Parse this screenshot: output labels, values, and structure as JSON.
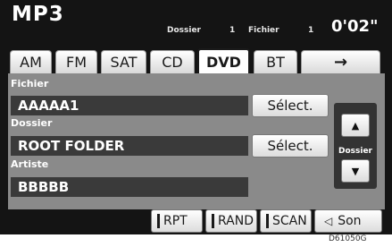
{
  "header": {
    "title": "MP3",
    "folder_label": "Dossier",
    "folder_number": "1",
    "file_label": "Fichier",
    "file_number": "1",
    "elapsed_time": "0'02\""
  },
  "tabs": [
    {
      "label": "AM"
    },
    {
      "label": "FM"
    },
    {
      "label": "SAT"
    },
    {
      "label": "CD"
    },
    {
      "label": "DVD",
      "active": true
    },
    {
      "label": "BT"
    },
    {
      "label": "→"
    }
  ],
  "fields": {
    "file": {
      "label": "Fichier",
      "value": "AAAAA1",
      "button": "Sélect."
    },
    "folder": {
      "label": "Dossier",
      "value": "ROOT FOLDER",
      "button": "Sélect."
    },
    "artist": {
      "label": "Artiste",
      "value": "BBBBB"
    }
  },
  "folder_nav": {
    "label": "Dossier",
    "up": "▲",
    "down": "▼"
  },
  "bottom_buttons": {
    "rpt": "RPT",
    "rand": "RAND",
    "scan": "SCAN",
    "sound": "Son",
    "sound_icon": "speaker-icon"
  },
  "image_code": "D61050G"
}
